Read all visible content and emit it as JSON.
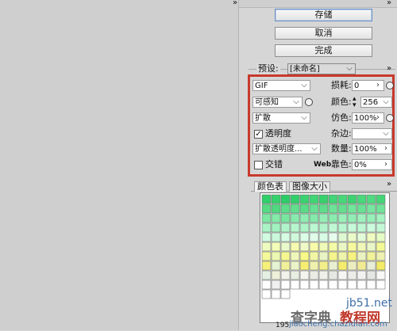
{
  "topbar": {
    "chevrons": "»"
  },
  "buttons": {
    "save": "存储",
    "cancel": "取消",
    "done": "完成"
  },
  "preset": {
    "label": "预设:",
    "value": "[未命名]"
  },
  "settings": {
    "format": "GIF",
    "reduction": "可感知",
    "dither_algo": "扩散",
    "transparency_label": "透明度",
    "transparency_checked": true,
    "transparency_dither": "扩散透明度...",
    "interlaced_label": "交错",
    "interlaced_checked": false,
    "lossy_label": "损耗:",
    "lossy_value": "0",
    "colors_label": "颜色:",
    "colors_value": "256",
    "dither_label": "仿色:",
    "dither_value": "100%",
    "matte_label": "杂边:",
    "amount_label": "数量:",
    "amount_value": "100%",
    "web_label": "Web",
    "websnap_label": "靠色:",
    "websnap_value": "0%"
  },
  "tabs": {
    "color_table": "颜色表",
    "image_size": "图像大小",
    "chevrons": "»"
  },
  "color_table": {
    "count": "195",
    "rows": [
      [
        "#2fd06a",
        "#35d16c",
        "#2ccd67",
        "#33cf6b",
        "#3ad270",
        "#40d574",
        "#38d06d",
        "#42d476",
        "#47d77a",
        "#3dd271",
        "#49d87b",
        "#50da80",
        "#45d576"
      ],
      [
        "#55db84",
        "#4ed87f",
        "#5bdd89",
        "#61df8d",
        "#58dc86",
        "#66e092",
        "#5edd8b",
        "#6ce396",
        "#64df90",
        "#71e59a",
        "#69e194",
        "#77e69f",
        "#6fe398"
      ],
      [
        "#7ce8a3",
        "#83eaa8",
        "#79e6a0",
        "#88ebad",
        "#8eedb1",
        "#84e9aa",
        "#93eeb5",
        "#8aebae",
        "#99f0b9",
        "#90edb3",
        "#9ef1bd",
        "#96efb7",
        "#a4f3c1"
      ],
      [
        "#a9f4c5",
        "#a1f2bf",
        "#b0f5c9",
        "#b6f6cd",
        "#acf4c7",
        "#bbf7d1",
        "#b3f5cb",
        "#c0f8d4",
        "#b8f6cf",
        "#c6f9d8",
        "#bef7d3",
        "#ccfadc",
        "#c3f8d6"
      ],
      [
        "#d1fbe0",
        "#c9f9da",
        "#d6fce3",
        "#cffada",
        "#dcfde6",
        "#e1fdea",
        "#d8fce5",
        "#e6fdee",
        "#def9d2",
        "#eafbc8",
        "#e2fbd8",
        "#effbbe",
        "#e5fcc4"
      ],
      [
        "#eefcc0",
        "#f3fcb8",
        "#e9fbca",
        "#f6fbb0",
        "#eef9c6",
        "#f8fca9",
        "#f0fab8",
        "#f3fba5",
        "#eaf7c4",
        "#f6fa9d",
        "#eff8b8",
        "#e8f6c8",
        "#f2f995"
      ],
      [
        "#f4fa9a",
        "#ecf8b2",
        "#f6f790",
        "#eef6ba",
        "#f8f888",
        "#f1f6a4",
        "#e9f3c4",
        "#f5f48c",
        "#eff4ab",
        "#f7f380",
        "#eaf2c0",
        "#f2f29a",
        "#eef0b0"
      ],
      [
        "#f5f07a",
        "#e6f3d2",
        "#f1f09a",
        "#eaf2c8",
        "#f6ee72",
        "#eef0ac",
        "#f2ee8a",
        "#e8efd0",
        "#f4ec6c",
        "#edeec0",
        "#f1ec94",
        "#e7edd6",
        "#f3ea66"
      ],
      [
        "#e4f0e2",
        "#eef0d8",
        "#f2f2ea",
        "#e8eee2",
        "#f4f4f0",
        "#eaece4",
        "#f0f0ea",
        "#e6e8e2",
        "#f6f6f2",
        "#ecece8",
        "#f2f2f0",
        "#e4e6e2",
        "#f8f8f6"
      ],
      [
        "#ffffff",
        "#f0f0f0",
        "#ffffff",
        "#ffffff",
        "#ffffff",
        "#ffffff",
        "#ffffff",
        "#ffffff",
        "#ffffff",
        "#ffffff",
        "#ffffff",
        "#ffffff",
        "#ffffff"
      ]
    ]
  },
  "watermark": {
    "site": "jb51.net",
    "brand_a": "查字典",
    "brand_b": "教程网",
    "url": "jiaocheng.chazidian.com"
  }
}
